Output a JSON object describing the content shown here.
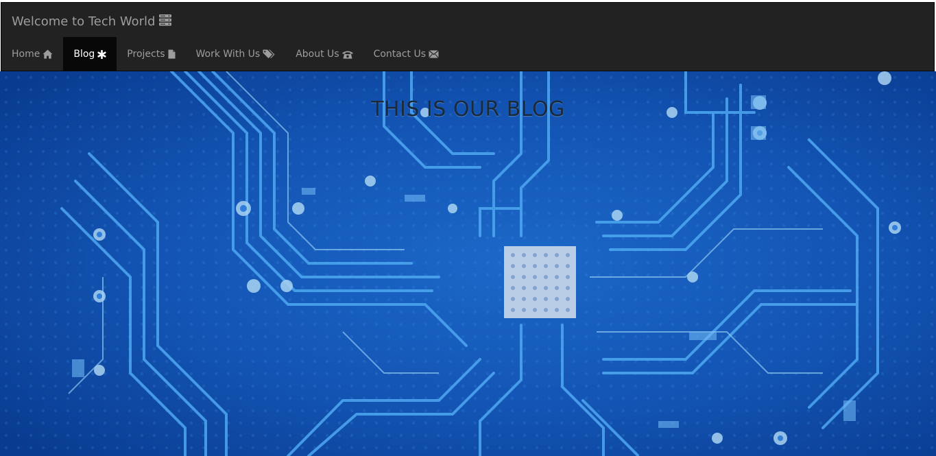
{
  "navbar": {
    "brand_text": "Welcome to Tech World",
    "brand_icon": "server-icon",
    "items": [
      {
        "label": "Home",
        "icon": "home-icon",
        "active": false
      },
      {
        "label": "Blog",
        "icon": "asterisk-icon",
        "active": true
      },
      {
        "label": "Projects",
        "icon": "file-icon",
        "active": false
      },
      {
        "label": "Work With Us",
        "icon": "tags-icon",
        "active": false
      },
      {
        "label": "About Us",
        "icon": "phone-icon",
        "active": false
      },
      {
        "label": "Contact Us",
        "icon": "envelope-icon",
        "active": false
      }
    ]
  },
  "hero": {
    "title": "THIS IS OUR BLOG",
    "background": "circuit-board-image"
  },
  "colors": {
    "navbar_bg": "#222222",
    "nav_text": "#9d9d9d",
    "nav_active_bg": "#080808",
    "nav_active_text": "#ffffff",
    "board_dark": "#0a3d91",
    "board_light": "#5ec3ff"
  }
}
